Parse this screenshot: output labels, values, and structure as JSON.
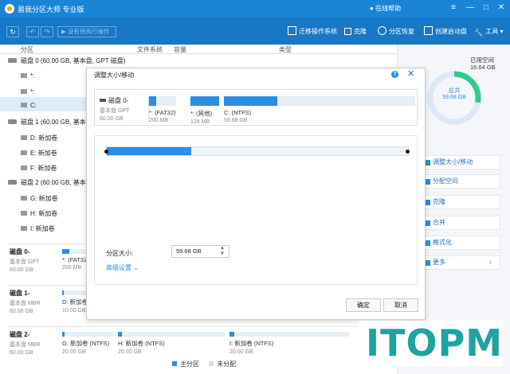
{
  "window": {
    "title": "易我分区大师 专业版",
    "online_help": "在线帮助",
    "controls": [
      "≡",
      "—",
      "□",
      "✕"
    ]
  },
  "toolbar": {
    "pending_label": "没有待执行操作",
    "items": [
      {
        "label": "迁移操作系统",
        "icon": "migrate-os-icon"
      },
      {
        "label": "克隆",
        "icon": "clone-icon"
      },
      {
        "label": "分区恢复",
        "icon": "partition-recovery-icon"
      },
      {
        "label": "创建启动盘",
        "icon": "bootable-media-icon"
      },
      {
        "label": "工具",
        "icon": "tools-icon"
      }
    ]
  },
  "columns": {
    "partition": "分区",
    "filesystem": "文件系统",
    "capacity": "容量",
    "type": "类型"
  },
  "tree": {
    "disk0": "磁盘 0 (60.00 GB, 基本盘, GPT 磁盘)",
    "disk0_parts": [
      "*:",
      "*:",
      "C:"
    ],
    "disk1": "磁盘 1 (60.00 GB, 基本盘, MBR 磁盘)",
    "disk1_parts": [
      "D: 新加卷",
      "E: 新加卷",
      "F: 新加卷"
    ],
    "disk2": "磁盘 2 (60.00 GB, 基本盘, MBR 磁盘)",
    "disk2_parts": [
      "G: 新加卷",
      "H: 新加卷",
      "I: 新加卷"
    ]
  },
  "disk_maps": [
    {
      "name": "磁盘 0-",
      "type": "基本盘 GPT",
      "size": "60.00 GB",
      "parts": [
        {
          "label": "*: (FAT32",
          "size": "200 MB",
          "fill": 0.25
        }
      ]
    },
    {
      "name": "磁盘 1-",
      "type": "基本盘 MBR",
      "size": "60.00 GB",
      "parts": [
        {
          "label": "D: 新加卷",
          "size": "10.00 GB",
          "fill": 0.05
        }
      ]
    },
    {
      "name": "磁盘 2-",
      "type": "基本盘 MBR",
      "size": "60.00 GB",
      "parts": [
        {
          "label": "G: 新加卷 (NTFS)",
          "size": "20.00 GB",
          "fill": 0.04
        },
        {
          "label": "H: 新加卷 (NTFS)",
          "size": "20.00 GB",
          "fill": 0.04
        },
        {
          "label": "I: 新加卷 (NTFS)",
          "size": "20.00 GB",
          "fill": 0.04
        }
      ]
    }
  ],
  "legend": {
    "primary": "主分区",
    "unallocated": "未分配",
    "primary_color": "#2b8de3",
    "unallocated_color": "#dddddd"
  },
  "right_panel": {
    "used_caption": "已用空间",
    "used_value": "16.64 GB",
    "total_caption": "总共",
    "total_value": "59.68 GB",
    "used_fraction": 0.28,
    "ops": [
      "调整大小/移动",
      "分配空间",
      "克隆",
      "合并",
      "格式化",
      "更多"
    ]
  },
  "dialog": {
    "title": "调整大小/移动",
    "disk_name": "磁盘 0-",
    "disk_type": "基本盘 GPT",
    "disk_size": "60.00 GB",
    "parts": [
      {
        "label": "*: (FAT32)",
        "size": "200 MB",
        "fill": 0.25
      },
      {
        "label": "*: (其他)",
        "size": "128 MB",
        "fill": 1.0
      },
      {
        "label": "C: (NTFS)",
        "size": "59.68 GB",
        "fill": 0.28
      }
    ],
    "slider_fill": 0.28,
    "size_label": "分区大小:",
    "size_value": "59.68 GB",
    "advanced": "高级设置",
    "ok": "确定",
    "cancel": "取消"
  },
  "watermark": "ITOPM",
  "accent_color": "#1a84d6"
}
